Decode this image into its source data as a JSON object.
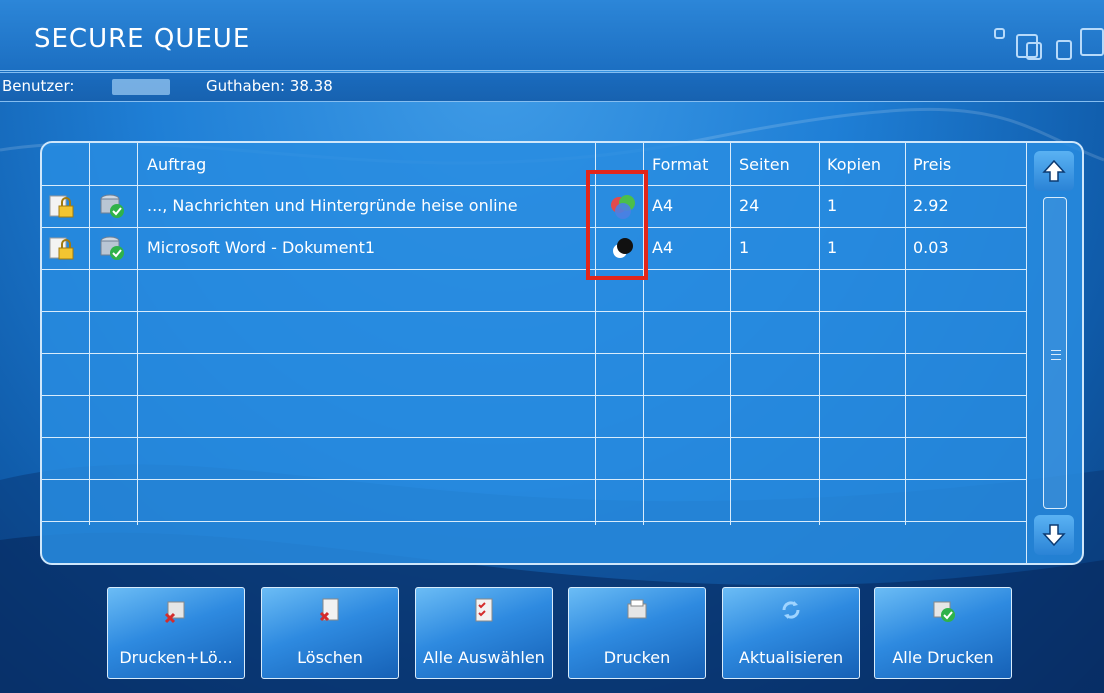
{
  "header": {
    "title": "SECURE QUEUE"
  },
  "userbar": {
    "user_label": "Benutzer:",
    "credit_label": "Guthaben: 38.38"
  },
  "table": {
    "columns": [
      "Auftrag",
      "Format",
      "Seiten",
      "Kopien",
      "Preis"
    ],
    "rows": [
      {
        "auftrag": "..., Nachrichten und Hintergründe heise online",
        "color_icon": "color-print-icon",
        "format": "A4",
        "seiten": "24",
        "kopien": "1",
        "preis": "2.92"
      },
      {
        "auftrag": "Microsoft Word - Dokument1",
        "color_icon": "bw-print-icon",
        "format": "A4",
        "seiten": "1",
        "kopien": "1",
        "preis": "0.03"
      }
    ]
  },
  "buttons": {
    "print_delete": "Drucken+Lö...",
    "delete": "Löschen",
    "select_all": "Alle Auswählen",
    "print": "Drucken",
    "refresh": "Aktualisieren",
    "print_all": "Alle Drucken"
  },
  "colors": {
    "highlight_box": "#e2261a",
    "background": "#1f7fd6"
  }
}
